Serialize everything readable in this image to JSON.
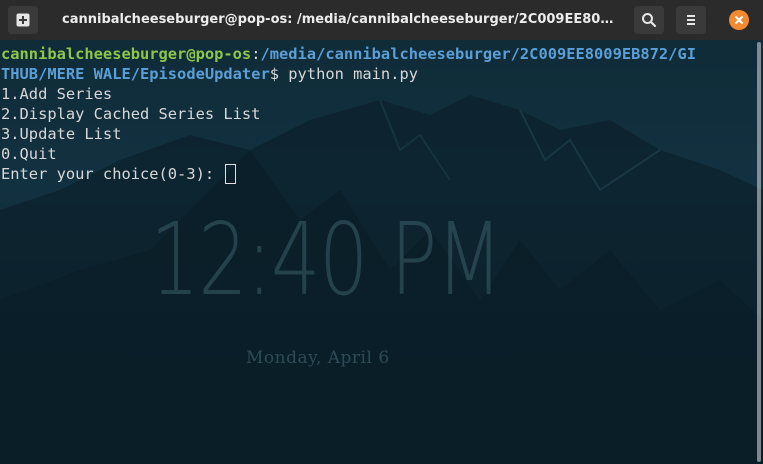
{
  "window": {
    "title": "cannibalcheeseburger@pop-os: /media/cannibalcheeseburger/2C009EE8009EB872/GITH…",
    "accent_close": "#f28b30"
  },
  "header": {
    "new_tab_icon": "new-tab-icon",
    "search_icon": "search-icon",
    "menu_icon": "hamburger-menu-icon",
    "close_icon": "close-icon"
  },
  "terminal": {
    "prompt_user": "cannibalcheeseburger@pop-os",
    "prompt_colon": ":",
    "prompt_path_line1": "/media/cannibalcheeseburger/2C009EE8009EB872/GI",
    "prompt_path_line2": "THUB/MERE WALE/EpisodeUpdater",
    "prompt_symbol": "$",
    "command": " python main.py",
    "menu": [
      "1.Add Series",
      "2.Display Cached Series List",
      "3.Update List",
      "0.Quit"
    ],
    "input_prompt": "Enter your choice(0-3): ",
    "colors": {
      "user": "#8ec64b",
      "path": "#5b9fd6",
      "text": "#d8d8d8"
    }
  },
  "background": {
    "clock": "12:40 PM",
    "date": "Monday, April 6"
  }
}
